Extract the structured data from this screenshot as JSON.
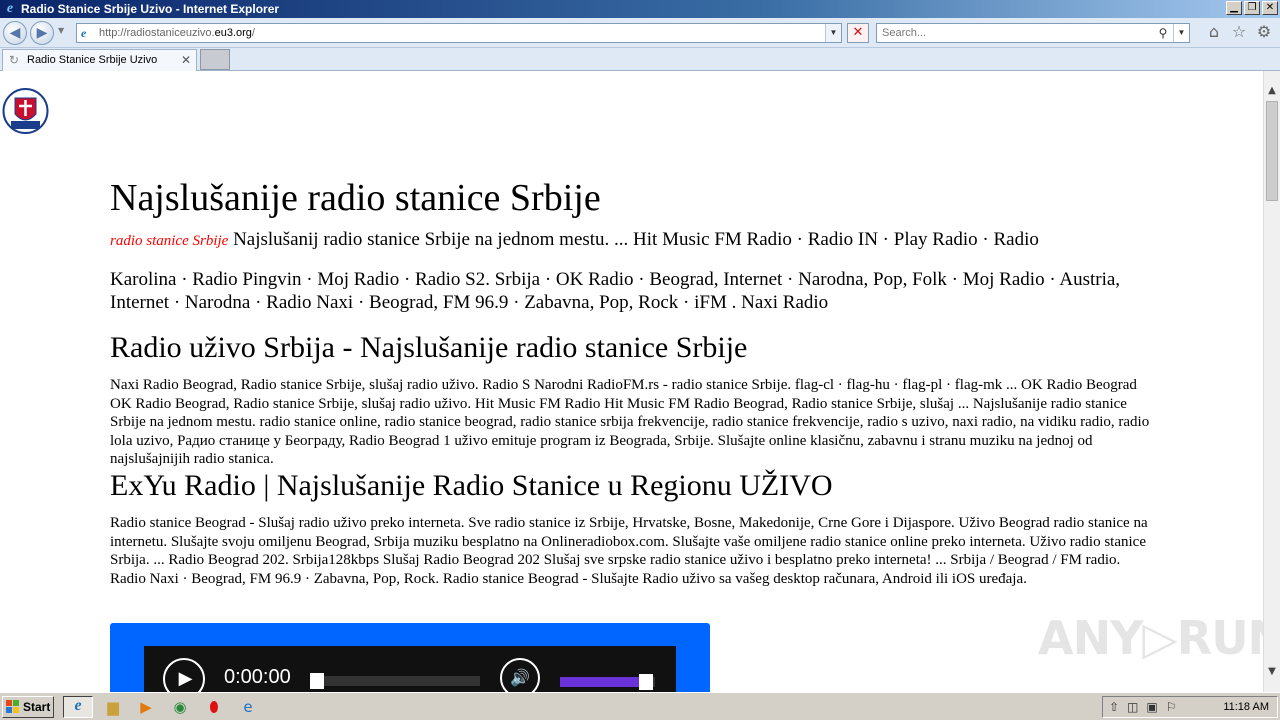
{
  "window": {
    "title": "Radio Stanice Srbije Uzivo - Internet Explorer",
    "min_glyph": "▁",
    "max_glyph": "❐",
    "close_glyph": "✕"
  },
  "navbar": {
    "address_prefix": "http://radiostaniceuzivo.",
    "address_host": "eu3.org",
    "address_suffix": "/",
    "search_placeholder": "Search...",
    "icons": [
      "back-arrow-icon",
      "forward-arrow-icon",
      "page-icon",
      "stop-icon",
      "search-icon",
      "home-icon",
      "favorites-star-icon",
      "tools-gear-icon"
    ]
  },
  "tabs": [
    {
      "label": "Radio Stanice Srbije Uzivo",
      "active": true
    }
  ],
  "page": {
    "heading": "Najslušanije radio stanice Srbije",
    "intro_red": "radio stanice Srbije",
    "intro_line1": " Najslušanij radio stanice Srbije na jednom mestu. ... Hit Music FM Radio · Radio IN · Play Radio · Radio",
    "intro_line2": "Karolina · Radio Pingvin · Moj Radio · Radio S2. Srbija · OK Radio · Beograd, Internet · Narodna, Pop, Folk · Moj Radio · Austria, Internet · Narodna · Radio Naxi · Beograd, FM 96.9 · Zabavna, Pop, Rock · iFM . Naxi Radio",
    "section1_heading": "Radio uživo Srbija - Najslušanije radio stanice Srbije",
    "section1_text": "Naxi Radio Beograd, Radio stanice Srbije, slušaj radio uživo. Radio S Narodni RadioFM.rs - radio stanice Srbije. flag-cl · flag-hu · flag-pl · flag-mk ... OK Radio Beograd OK Radio Beograd, Radio stanice Srbije, slušaj radio uživo. Hit Music FM Radio Hit Music FM Radio Beograd, Radio stanice Srbije, slušaj ... Najslušanije radio stanice Srbije na jednom mestu. radio stanice online, radio stanice beograd, radio stanice srbija frekvencije, radio stanice frekvencije, radio s uzivo, naxi radio, na vidiku radio, radio lola uzivo, Радио станице у Београду, Radio Beograd 1 uživo emituje program iz Beograda, Srbije. Slušajte online klasičnu, zabavnu i stranu muziku na jednoj od najslušajnijih radio stanica.",
    "section2_heading": "ExYu Radio | Najslušanije Radio Stanice u Regionu UŽIVO",
    "section2_text": "Radio stanice Beograd - Slušaj radio uživo preko interneta. Sve radio stanice iz Srbije, Hrvatske, Bosne, Makedonije, Crne Gore i Dijaspore. Uživo Beograd radio stanice na internetu. Slušajte svoju omiljenu Beograd, Srbija muziku besplatno na Onlineradiobox.com. Slušajte vaše omiljene radio stanice online preko interneta. Uživo radio stanice Srbija. ... Radio Beograd 202. Srbija128kbps Slušaj Radio Beograd 202 Slušaj sve srpske radio stanice uživo i besplatno preko interneta! ... Srbija / Beograd / FM radio. Radio Naxi · Beograd, FM 96.9 · Zabavna, Pop, Rock. Radio stanice Beograd - Slušajte Radio uživo sa vašeg desktop računara, Android ili iOS uređaja."
  },
  "player": {
    "time": "0:00:00",
    "seek_fraction": 0,
    "volume_fraction": 0.85,
    "accent_color": "#0066ff",
    "volume_color": "#6a32d8"
  },
  "watermark": "ANY▷RUN",
  "taskbar": {
    "start_label": "Start",
    "clock": "11:18 AM",
    "apps": [
      "internet-explorer-icon",
      "file-explorer-icon",
      "media-player-icon",
      "chrome-icon",
      "opera-icon",
      "edge-icon"
    ]
  }
}
